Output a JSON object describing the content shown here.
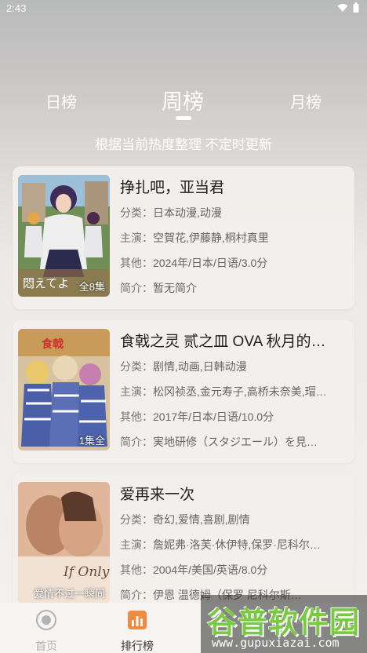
{
  "status": {
    "time": "2:43"
  },
  "tabs": {
    "day": "日榜",
    "week": "周榜",
    "month": "月榜",
    "active": "周榜"
  },
  "subtitle": "根据当前热度整理 不定时更新",
  "labels": {
    "genre": "分类：",
    "cast": "主演：",
    "other": "其他：",
    "intro": "简介："
  },
  "items": [
    {
      "title": "挣扎吧，亚当君",
      "genre": "日本动漫,动漫",
      "cast": "空賀花,伊藤静,桐村真里",
      "other": "2024年/日本/日语/3.0分",
      "intro": "暂无简介",
      "badge": "全8集",
      "poster_text": "悶えてよ、アダム"
    },
    {
      "title": "食戟之灵 贰之皿 OVA 秋月的…",
      "genre": "剧情,动画,日韩动漫",
      "cast": "松冈祯丞,金元寿子,高桥未奈美,瑁…",
      "other": "2017年/日本/日语/10.0分",
      "intro": "実地研修（スタジエール）を見…",
      "badge": "1集全",
      "poster_text": "食戟のソーマ"
    },
    {
      "title": "爱再来一次",
      "genre": "奇幻,爱情,喜剧,剧情",
      "cast": "詹妮弗·洛芙·休伊特,保罗·尼科尔…",
      "other": "2004年/美国/英语/8.0分",
      "intro": "伊恩 温德姆（保罗 尼科尔斯…",
      "badge": "爱情不过一瞬间",
      "poster_text": "If Only"
    }
  ],
  "nav": {
    "home": "首页",
    "rank": "排行榜"
  },
  "watermark": {
    "main": "谷普软件园",
    "sub": "www.gupuxiazai.com"
  }
}
